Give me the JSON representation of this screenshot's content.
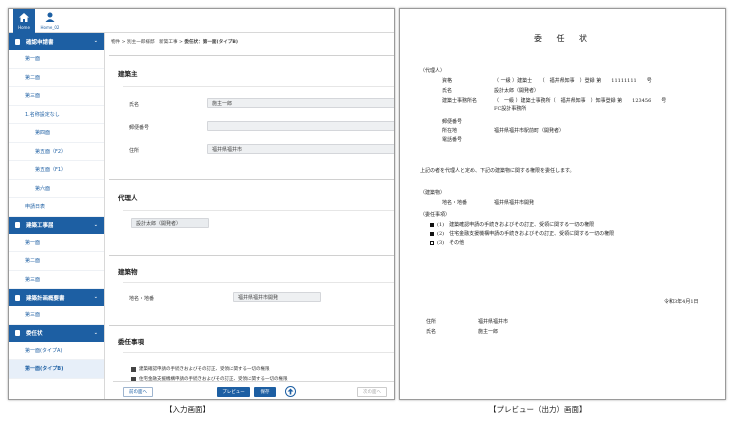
{
  "input_screen": {
    "top_buttons": {
      "home": "Home",
      "user": "Home_02"
    },
    "sidebar": {
      "sec1": "確認申請書",
      "sec1_items": [
        "第一面",
        "第二面",
        "第三面",
        "1.名称設定なし",
        "第四面",
        "第五面（F2）",
        "第五面（F1）",
        "第六面",
        "申請日表"
      ],
      "sec2": "建築工事届",
      "sec2_items": [
        "第一面",
        "第二面",
        "第三面"
      ],
      "sec3": "建築計画概要書",
      "sec3_items": [
        "第三面"
      ],
      "sec4": "委任状",
      "sec4_items": [
        "第一面(タイプA)",
        "第一面(タイプB)"
      ]
    },
    "breadcrumb": {
      "a": "物件",
      "sep1": ">",
      "b": "別主一郎様邸　新築工事",
      "sep2": ">",
      "c": "委任状：第一面(タイプB)"
    },
    "owner": {
      "title": "建築主",
      "name_label": "氏名",
      "name_value": "施主一郎",
      "zip_label": "郵便番号",
      "zip_value": "",
      "address_label": "住所",
      "address_value": "福井県福井市"
    },
    "agent": {
      "title": "代理人",
      "chip": "設計太郎（開発者）"
    },
    "building": {
      "title": "建築物",
      "location_label": "地名・地番",
      "location_value": "福井県福井市開発"
    },
    "delegation": {
      "title": "委任事項",
      "item1": "建築確認申請の手続きおよびその訂正、受領に関する一切の権限",
      "item2": "住宅金融支援機構申請の手続きおよびその訂正、受領に関する一切の権限"
    },
    "footer": {
      "prev": "前の面へ",
      "preview": "プレビュー",
      "save": "保存",
      "next": "次の面へ"
    }
  },
  "preview_screen": {
    "title": "委 任 状",
    "agent_header": "（代理人）",
    "qual_label": "資格",
    "qual_value": "（ 一級 ）建築士　　（　福井県知事　）登録 第　　11111111　　号",
    "name_label": "氏名",
    "name_value": "設計太郎（開発者）",
    "office_label": "建築士事務所名",
    "office_value": "（　一級 ）建築士事務所（　福井県知事　）知事登録 第　　123456　　号",
    "office_name": "FC設計事務所",
    "mail_label": "郵便番号",
    "addr_label": "所在地",
    "addr_value": "福井県福井市駅前町（開発者）",
    "tel_label": "電話番号",
    "statement": "上記の者を代理人と定め、下記の建築物に関する権限を委任します。",
    "building_header": "（建築物）",
    "location_label": "地名・地番",
    "location_value": "福井県福井市開発",
    "matters_header": "（委任事項）",
    "matter1": "(1)　建築確認申請の手続きおよびその訂正、受領に関する一切の権限",
    "matter2": "(2)　住宅金融支援機構申請の手続きおよびその訂正、受領に関する一切の権限",
    "matter3": "(3)　その他",
    "date": "令和3年4月1日",
    "sign_addr_label": "住所",
    "sign_addr_value": "福井県福井市",
    "sign_name_label": "氏名",
    "sign_name_value": "施主一郎"
  },
  "captions": {
    "left": "【入力画面】",
    "right": "【プレビュー（出力）画面】"
  },
  "colors": {
    "accent": "#1d5fa3"
  }
}
